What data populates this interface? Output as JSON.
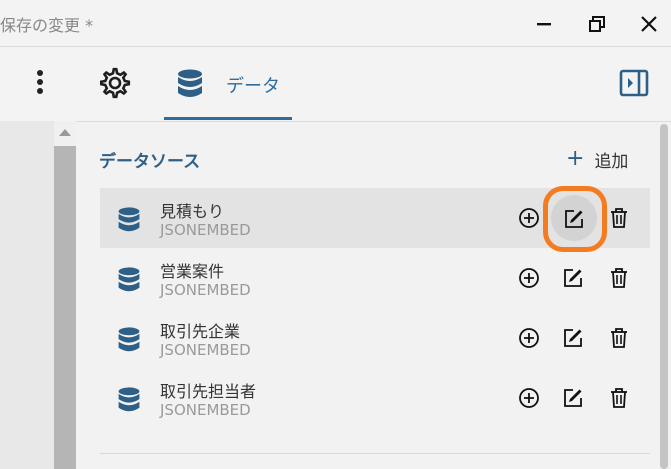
{
  "window": {
    "title": "保存の変更 *",
    "minimize_icon": "minimize-icon",
    "restore_icon": "restore-icon",
    "close_icon": "close-icon"
  },
  "toolbar": {
    "more_icon": "more-vertical-icon",
    "settings_icon": "gear-icon",
    "data_tab_label": "データ",
    "panel_icon": "panel-toggle-icon"
  },
  "datasources": {
    "title": "データソース",
    "add_label": "追加",
    "items": [
      {
        "name": "見積もり",
        "type": "JSONEMBED",
        "selected": true
      },
      {
        "name": "営業案件",
        "type": "JSONEMBED",
        "selected": false
      },
      {
        "name": "取引先企業",
        "type": "JSONEMBED",
        "selected": false
      },
      {
        "name": "取引先担当者",
        "type": "JSONEMBED",
        "selected": false
      }
    ]
  },
  "colors": {
    "accent": "#2e6b9e",
    "highlight": "#f47b20"
  }
}
